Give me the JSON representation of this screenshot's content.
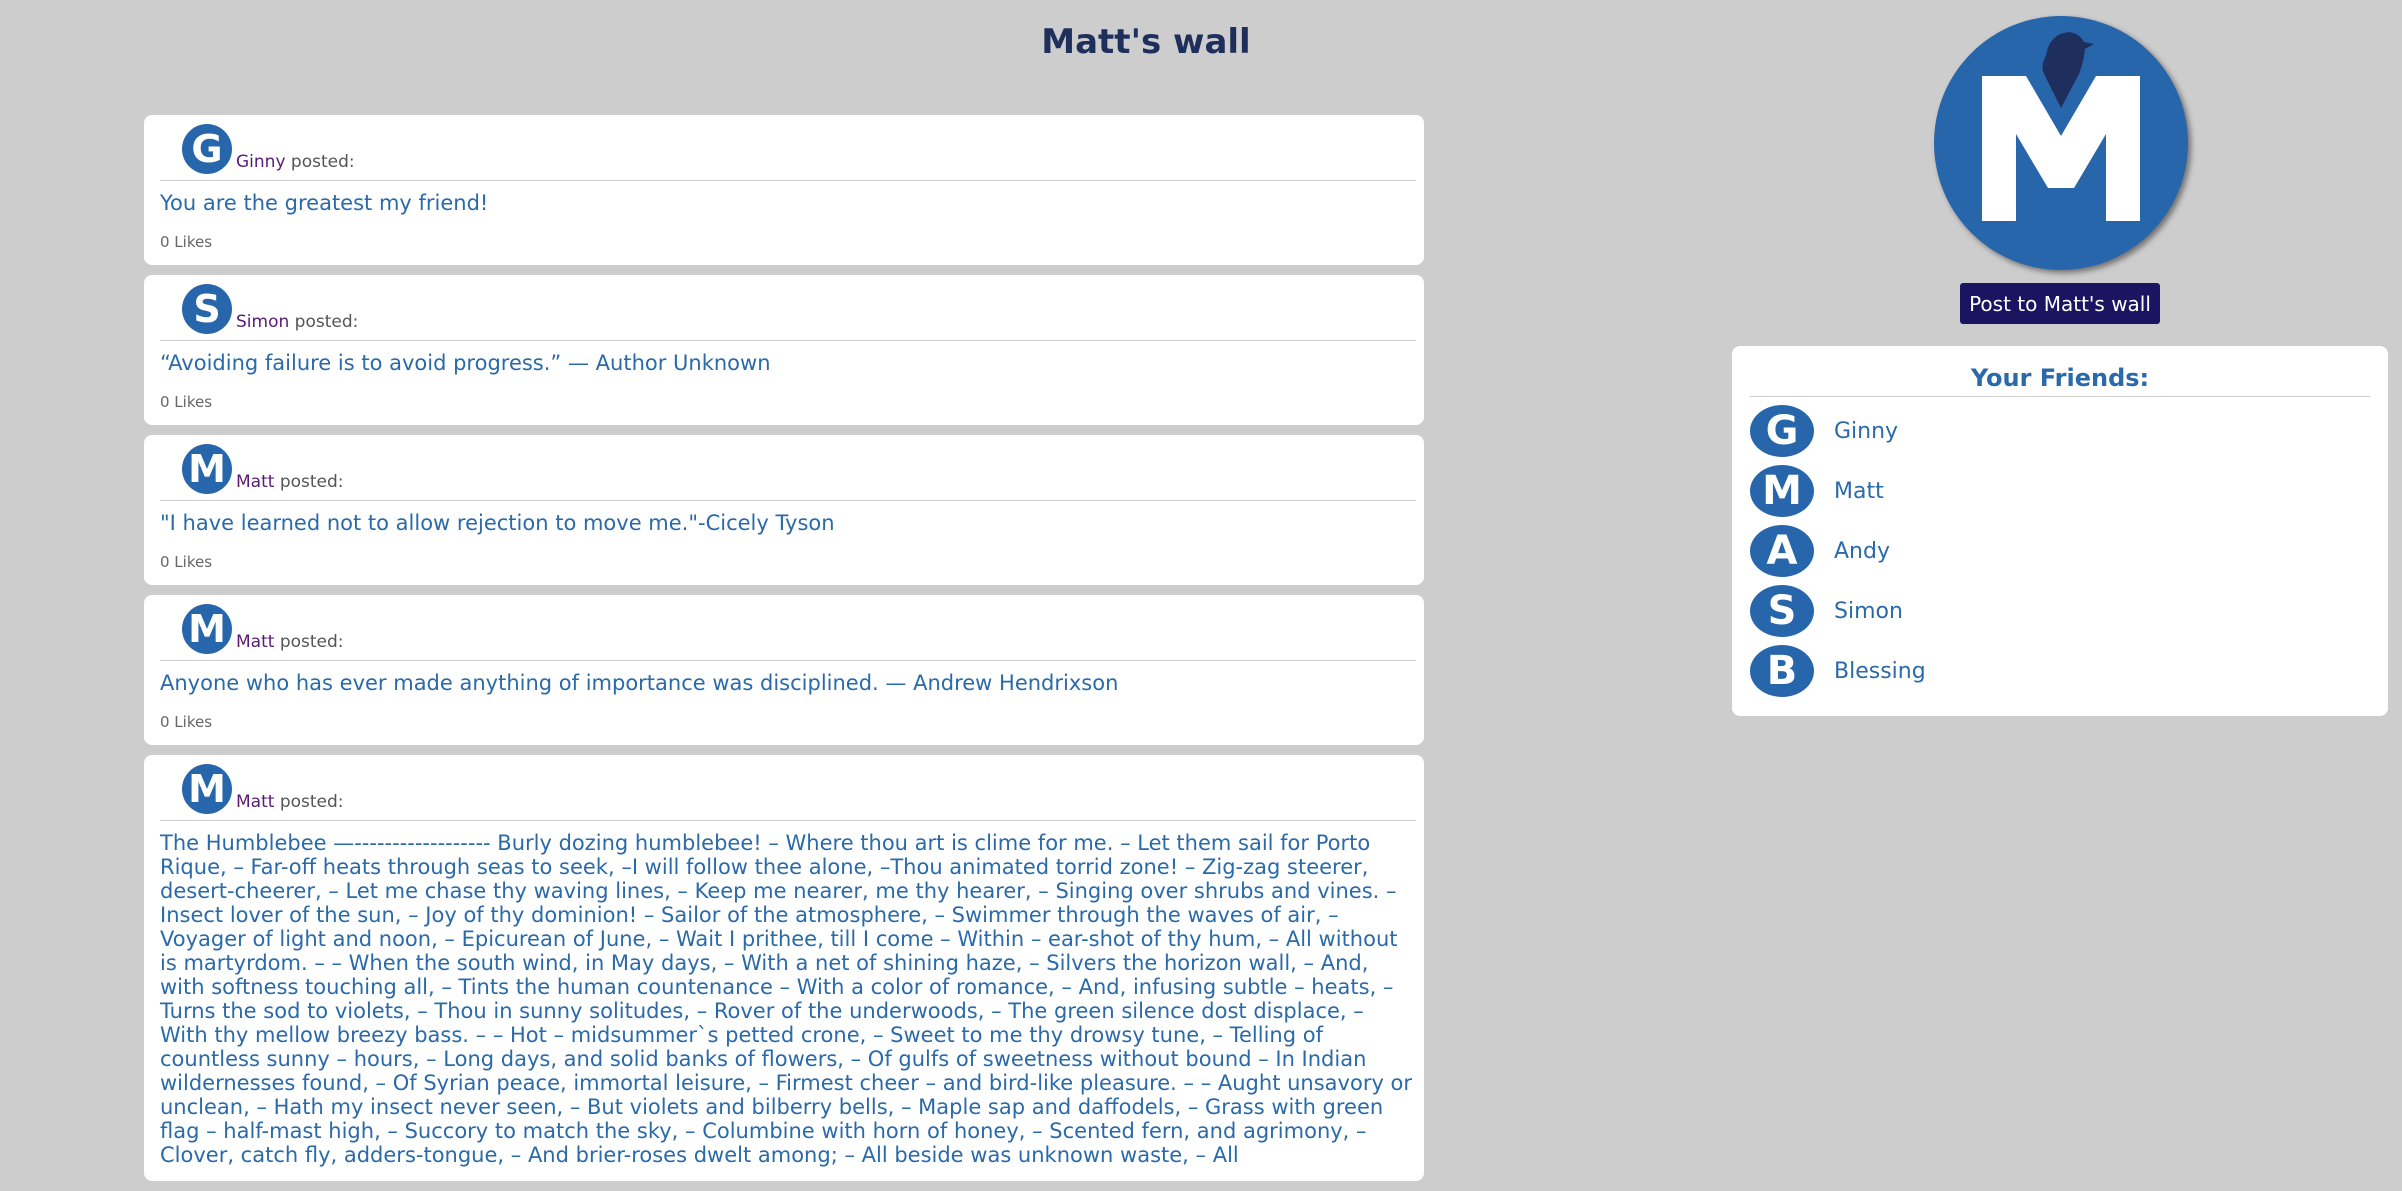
{
  "page": {
    "title": "Matt's wall"
  },
  "posts": [
    {
      "author": "Ginny",
      "author_initial": "G",
      "posted_label": "posted:",
      "content": "You are the greatest my friend!",
      "likes": "0 Likes"
    },
    {
      "author": "Simon",
      "author_initial": "S",
      "posted_label": "posted:",
      "content": "“Avoiding failure is to avoid progress.” — Author Unknown",
      "likes": "0 Likes"
    },
    {
      "author": "Matt",
      "author_initial": "M",
      "posted_label": "posted:",
      "content": "\"I have learned not to allow rejection to move me.\"-Cicely Tyson",
      "likes": "0 Likes"
    },
    {
      "author": "Matt",
      "author_initial": "M",
      "posted_label": "posted:",
      "content": "Anyone who has ever made anything of importance was disciplined. — Andrew Hendrixson",
      "likes": "0 Likes"
    },
    {
      "author": "Matt",
      "author_initial": "M",
      "posted_label": "posted:",
      "content": "The Humblebee —------------------ Burly dozing humblebee! – Where thou art is clime for me. – Let them sail for Porto Rique, – Far-off heats through seas to seek, –I will follow thee alone, –Thou animated torrid zone! – Zig-zag steerer, desert-cheerer, – Let me chase thy waving lines, – Keep me nearer, me thy hearer, – Singing over shrubs and vines. – Insect lover of the sun, – Joy of thy dominion! – Sailor of the atmosphere, – Swimmer through the waves of air, – Voyager of light and noon, – Epicurean of June, – Wait I prithee, till I come – Within – ear-shot of thy hum, – All without is martyrdom. – – When the south wind, in May days, – With a net of shining haze, – Silvers the horizon wall, – And, with softness touching all, – Tints the human countenance – With a color of romance, – And, infusing subtle – heats, – Turns the sod to violets, – Thou in sunny solitudes, – Rover of the underwoods, – The green silence dost displace, – With thy mellow breezy bass. – – Hot – midsummer`s petted crone, – Sweet to me thy drowsy tune, – Telling of countless sunny – hours, – Long days, and solid banks of flowers, – Of gulfs of sweetness without bound – In Indian wildernesses found, – Of Syrian peace, immortal leisure, – Firmest cheer – and bird-like pleasure. – – Aught unsavory or unclean, – Hath my insect never seen, – But violets and bilberry bells, – Maple sap and daffodels, – Grass with green flag – half-mast high, – Succory to match the sky, – Columbine with horn of honey, – Scented fern, and agrimony, – Clover, catch fly, adders-tongue, – And brier-roses dwelt among; – All beside was unknown waste, – All",
      "likes": ""
    }
  ],
  "profile": {
    "initial": "M",
    "post_button_label": "Post to Matt's wall"
  },
  "friends": {
    "title": "Your Friends:",
    "items": [
      {
        "name": "Ginny",
        "initial": "G"
      },
      {
        "name": "Matt",
        "initial": "M"
      },
      {
        "name": "Andy",
        "initial": "A"
      },
      {
        "name": "Simon",
        "initial": "S"
      },
      {
        "name": "Blessing",
        "initial": "B"
      }
    ]
  },
  "colors": {
    "accent": "#2866ab",
    "button": "#1b1460",
    "background": "#cdcdce",
    "author": "#5a1a73"
  }
}
